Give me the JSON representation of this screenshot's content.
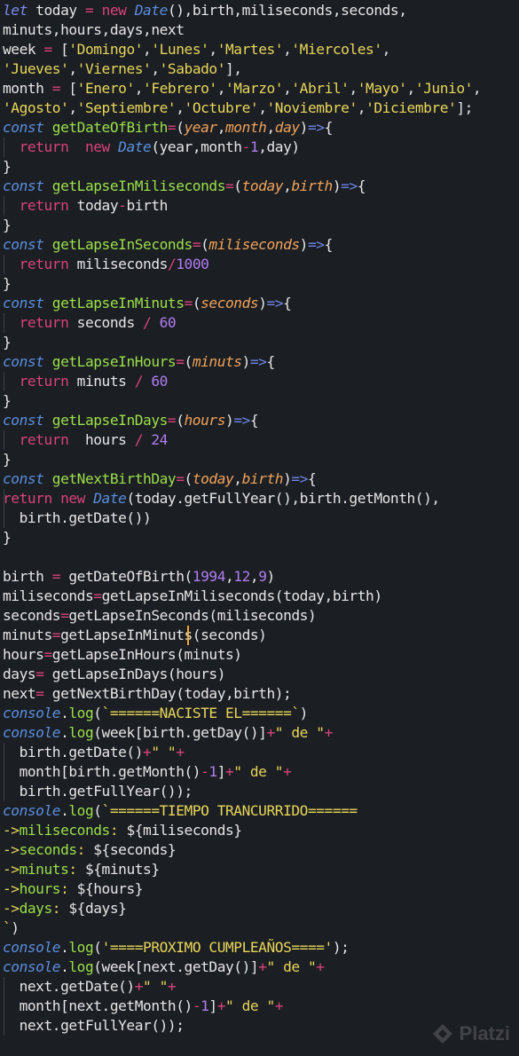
{
  "theme": {
    "background": "#1b1e23",
    "keyword": "#d8437a",
    "function_name": "#9be04a",
    "string": "#e8d65a",
    "number": "#b07ef0",
    "parameter": "#f0a35a",
    "declaration": "#5a8fe0"
  },
  "code": {
    "lines": [
      [
        [
          "let",
          "let"
        ],
        [
          "plain",
          " today "
        ],
        [
          "op",
          "="
        ],
        [
          "plain",
          " "
        ],
        [
          "kw",
          "new"
        ],
        [
          "plain",
          " "
        ],
        [
          "cls",
          "Date"
        ],
        [
          "plain",
          "(),birth,miliseconds,seconds,"
        ]
      ],
      [
        [
          "plain",
          "minuts,hours,days,next"
        ]
      ],
      [
        [
          "plain",
          "week "
        ],
        [
          "op",
          "="
        ],
        [
          "plain",
          " ["
        ],
        [
          "str",
          "'Domingo'"
        ],
        [
          "plain",
          ","
        ],
        [
          "str",
          "'Lunes'"
        ],
        [
          "plain",
          ","
        ],
        [
          "str",
          "'Martes'"
        ],
        [
          "plain",
          ","
        ],
        [
          "str",
          "'Miercoles'"
        ],
        [
          "plain",
          ","
        ]
      ],
      [
        [
          "str",
          "'Jueves'"
        ],
        [
          "plain",
          ","
        ],
        [
          "str",
          "'Viernes'"
        ],
        [
          "plain",
          ","
        ],
        [
          "str",
          "'Sabado'"
        ],
        [
          "plain",
          "],"
        ]
      ],
      [
        [
          "plain",
          "month "
        ],
        [
          "op",
          "="
        ],
        [
          "plain",
          " ["
        ],
        [
          "str",
          "'Enero'"
        ],
        [
          "plain",
          ","
        ],
        [
          "str",
          "'Febrero'"
        ],
        [
          "plain",
          ","
        ],
        [
          "str",
          "'Marzo'"
        ],
        [
          "plain",
          ","
        ],
        [
          "str",
          "'Abril'"
        ],
        [
          "plain",
          ","
        ],
        [
          "str",
          "'Mayo'"
        ],
        [
          "plain",
          ","
        ],
        [
          "str",
          "'Junio'"
        ],
        [
          "plain",
          ","
        ]
      ],
      [
        [
          "str",
          "'Agosto'"
        ],
        [
          "plain",
          ","
        ],
        [
          "str",
          "'Septiembre'"
        ],
        [
          "plain",
          ","
        ],
        [
          "str",
          "'Octubre'"
        ],
        [
          "plain",
          ","
        ],
        [
          "str",
          "'Noviembre'"
        ],
        [
          "plain",
          ","
        ],
        [
          "str",
          "'Diciembre'"
        ],
        [
          "plain",
          "];"
        ]
      ],
      [
        [
          "cons",
          "const"
        ],
        [
          "plain",
          " "
        ],
        [
          "fn",
          "getDateOfBirth"
        ],
        [
          "op",
          "="
        ],
        [
          "plain",
          "("
        ],
        [
          "par",
          "year"
        ],
        [
          "plain",
          ","
        ],
        [
          "par",
          "month"
        ],
        [
          "plain",
          ","
        ],
        [
          "par",
          "day"
        ],
        [
          "plain",
          ")"
        ],
        [
          "arrw",
          "=>"
        ],
        [
          "plain",
          "{"
        ]
      ],
      [
        [
          "plain",
          "  "
        ],
        [
          "kw",
          "return"
        ],
        [
          "plain",
          "  "
        ],
        [
          "kw",
          "new"
        ],
        [
          "plain",
          " "
        ],
        [
          "cls",
          "Date"
        ],
        [
          "plain",
          "(year,month"
        ],
        [
          "op",
          "-"
        ],
        [
          "num",
          "1"
        ],
        [
          "plain",
          ",day)"
        ]
      ],
      [
        [
          "plain",
          "}"
        ]
      ],
      [
        [
          "cons",
          "const"
        ],
        [
          "plain",
          " "
        ],
        [
          "fn",
          "getLapseInMiliseconds"
        ],
        [
          "op",
          "="
        ],
        [
          "plain",
          "("
        ],
        [
          "par",
          "today"
        ],
        [
          "plain",
          ","
        ],
        [
          "par",
          "birth"
        ],
        [
          "plain",
          ")"
        ],
        [
          "arrw",
          "=>"
        ],
        [
          "plain",
          "{"
        ]
      ],
      [
        [
          "plain",
          "  "
        ],
        [
          "kw",
          "return"
        ],
        [
          "plain",
          " today"
        ],
        [
          "op",
          "-"
        ],
        [
          "plain",
          "birth"
        ]
      ],
      [
        [
          "plain",
          "}"
        ]
      ],
      [
        [
          "cons",
          "const"
        ],
        [
          "plain",
          " "
        ],
        [
          "fn",
          "getLapseInSeconds"
        ],
        [
          "op",
          "="
        ],
        [
          "plain",
          "("
        ],
        [
          "par",
          "miliseconds"
        ],
        [
          "plain",
          ")"
        ],
        [
          "arrw",
          "=>"
        ],
        [
          "plain",
          "{"
        ]
      ],
      [
        [
          "plain",
          "  "
        ],
        [
          "kw",
          "return"
        ],
        [
          "plain",
          " miliseconds"
        ],
        [
          "op",
          "/"
        ],
        [
          "num",
          "1000"
        ]
      ],
      [
        [
          "plain",
          "}"
        ]
      ],
      [
        [
          "cons",
          "const"
        ],
        [
          "plain",
          " "
        ],
        [
          "fn",
          "getLapseInMinuts"
        ],
        [
          "op",
          "="
        ],
        [
          "plain",
          "("
        ],
        [
          "par",
          "seconds"
        ],
        [
          "plain",
          ")"
        ],
        [
          "arrw",
          "=>"
        ],
        [
          "plain",
          "{"
        ]
      ],
      [
        [
          "plain",
          "  "
        ],
        [
          "kw",
          "return"
        ],
        [
          "plain",
          " seconds "
        ],
        [
          "op",
          "/"
        ],
        [
          "plain",
          " "
        ],
        [
          "num",
          "60"
        ]
      ],
      [
        [
          "plain",
          "}"
        ]
      ],
      [
        [
          "cons",
          "const"
        ],
        [
          "plain",
          " "
        ],
        [
          "fn",
          "getLapseInHours"
        ],
        [
          "op",
          "="
        ],
        [
          "plain",
          "("
        ],
        [
          "par",
          "minuts"
        ],
        [
          "plain",
          ")"
        ],
        [
          "arrw",
          "=>"
        ],
        [
          "plain",
          "{"
        ]
      ],
      [
        [
          "plain",
          "  "
        ],
        [
          "kw",
          "return"
        ],
        [
          "plain",
          " minuts "
        ],
        [
          "op",
          "/"
        ],
        [
          "plain",
          " "
        ],
        [
          "num",
          "60"
        ]
      ],
      [
        [
          "plain",
          "}"
        ]
      ],
      [
        [
          "cons",
          "const"
        ],
        [
          "plain",
          " "
        ],
        [
          "fn",
          "getLapseInDays"
        ],
        [
          "op",
          "="
        ],
        [
          "plain",
          "("
        ],
        [
          "par",
          "hours"
        ],
        [
          "plain",
          ")"
        ],
        [
          "arrw",
          "=>"
        ],
        [
          "plain",
          "{"
        ]
      ],
      [
        [
          "plain",
          "  "
        ],
        [
          "kw",
          "return"
        ],
        [
          "plain",
          "  hours "
        ],
        [
          "op",
          "/"
        ],
        [
          "plain",
          " "
        ],
        [
          "num",
          "24"
        ]
      ],
      [
        [
          "plain",
          "}"
        ]
      ],
      [
        [
          "cons",
          "const"
        ],
        [
          "plain",
          " "
        ],
        [
          "fn",
          "getNextBirthDay"
        ],
        [
          "op",
          "="
        ],
        [
          "plain",
          "("
        ],
        [
          "par",
          "today"
        ],
        [
          "plain",
          ","
        ],
        [
          "par",
          "birth"
        ],
        [
          "plain",
          ")"
        ],
        [
          "arrw",
          "=>"
        ],
        [
          "plain",
          "{"
        ]
      ],
      [
        [
          "kw",
          "return"
        ],
        [
          "plain",
          " "
        ],
        [
          "kw",
          "new"
        ],
        [
          "plain",
          " "
        ],
        [
          "cls",
          "Date"
        ],
        [
          "plain",
          "(today.getFullYear(),birth.getMonth(),"
        ]
      ],
      [
        [
          "plain",
          "  birth.getDate())"
        ]
      ],
      [
        [
          "plain",
          "}"
        ]
      ],
      [
        [
          "plain",
          ""
        ]
      ],
      [
        [
          "plain",
          "birth "
        ],
        [
          "op",
          "="
        ],
        [
          "plain",
          " getDateOfBirth("
        ],
        [
          "num",
          "1994"
        ],
        [
          "plain",
          ","
        ],
        [
          "num",
          "12"
        ],
        [
          "plain",
          ","
        ],
        [
          "num",
          "9"
        ],
        [
          "plain",
          ")"
        ]
      ],
      [
        [
          "plain",
          "miliseconds"
        ],
        [
          "op",
          "="
        ],
        [
          "plain",
          "getLapseInMiliseconds(today,birth)"
        ]
      ],
      [
        [
          "plain",
          "seconds"
        ],
        [
          "op",
          "="
        ],
        [
          "plain",
          "getLapseInSeconds(miliseconds)"
        ]
      ],
      [
        [
          "plain",
          "minuts"
        ],
        [
          "op",
          "="
        ],
        [
          "plain",
          "getLapseInMinuts(seconds)"
        ]
      ],
      [
        [
          "plain",
          "hours"
        ],
        [
          "op",
          "="
        ],
        [
          "plain",
          "getLapseInHours(minuts)"
        ]
      ],
      [
        [
          "plain",
          "days"
        ],
        [
          "op",
          "="
        ],
        [
          "plain",
          " getLapseInDays(hours)"
        ]
      ],
      [
        [
          "plain",
          "next"
        ],
        [
          "op",
          "="
        ],
        [
          "plain",
          " getNextBirthDay(today,birth);"
        ]
      ],
      [
        [
          "cons",
          "console"
        ],
        [
          "plain",
          "."
        ],
        [
          "fn",
          "log"
        ],
        [
          "plain",
          "("
        ],
        [
          "str",
          "`======NACISTE EL======`"
        ],
        [
          "plain",
          ")"
        ]
      ],
      [
        [
          "cons",
          "console"
        ],
        [
          "plain",
          "."
        ],
        [
          "fn",
          "log"
        ],
        [
          "plain",
          "(week[birth.getDay()]"
        ],
        [
          "op",
          "+"
        ],
        [
          "str",
          "\" de \""
        ],
        [
          "op",
          "+"
        ]
      ],
      [
        [
          "plain",
          "  birth.getDate()"
        ],
        [
          "op",
          "+"
        ],
        [
          "str",
          "\" \""
        ],
        [
          "op",
          "+"
        ]
      ],
      [
        [
          "plain",
          "  month[birth.getMonth()"
        ],
        [
          "op",
          "-"
        ],
        [
          "num",
          "1"
        ],
        [
          "plain",
          "]"
        ],
        [
          "op",
          "+"
        ],
        [
          "str",
          "\" de \""
        ],
        [
          "op",
          "+"
        ]
      ],
      [
        [
          "plain",
          "  birth.getFullYear());"
        ]
      ],
      [
        [
          "cons",
          "console"
        ],
        [
          "plain",
          "."
        ],
        [
          "fn",
          "log"
        ],
        [
          "plain",
          "("
        ],
        [
          "str",
          "`======TIEMPO TRANCURRIDO======"
        ]
      ],
      [
        [
          "str",
          "->"
        ],
        [
          "fn",
          "miliseconds"
        ],
        [
          "str",
          ": "
        ],
        [
          "plain",
          "${miliseconds}"
        ]
      ],
      [
        [
          "str",
          "->"
        ],
        [
          "fn",
          "seconds"
        ],
        [
          "str",
          ": "
        ],
        [
          "plain",
          "${seconds}"
        ]
      ],
      [
        [
          "str",
          "->"
        ],
        [
          "fn",
          "minuts"
        ],
        [
          "str",
          ": "
        ],
        [
          "plain",
          "${minuts}"
        ]
      ],
      [
        [
          "str",
          "->"
        ],
        [
          "fn",
          "hours"
        ],
        [
          "str",
          ": "
        ],
        [
          "plain",
          "${hours}"
        ]
      ],
      [
        [
          "str",
          "->"
        ],
        [
          "fn",
          "days"
        ],
        [
          "str",
          ": "
        ],
        [
          "plain",
          "${days}"
        ]
      ],
      [
        [
          "str",
          "`"
        ],
        [
          "plain",
          ")"
        ]
      ],
      [
        [
          "cons",
          "console"
        ],
        [
          "plain",
          "."
        ],
        [
          "fn",
          "log"
        ],
        [
          "plain",
          "("
        ],
        [
          "str",
          "'====PROXIMO CUMPLEAÑOS===='"
        ],
        [
          "plain",
          ");"
        ]
      ],
      [
        [
          "cons",
          "console"
        ],
        [
          "plain",
          "."
        ],
        [
          "fn",
          "log"
        ],
        [
          "plain",
          "(week[next.getDay()]"
        ],
        [
          "op",
          "+"
        ],
        [
          "str",
          "\" de \""
        ],
        [
          "op",
          "+"
        ]
      ],
      [
        [
          "plain",
          "  next.getDate()"
        ],
        [
          "op",
          "+"
        ],
        [
          "str",
          "\" \""
        ],
        [
          "op",
          "+"
        ]
      ],
      [
        [
          "plain",
          "  month[next.getMonth()"
        ],
        [
          "op",
          "-"
        ],
        [
          "num",
          "1"
        ],
        [
          "plain",
          "]"
        ],
        [
          "op",
          "+"
        ],
        [
          "str",
          "\" de \""
        ],
        [
          "op",
          "+"
        ]
      ],
      [
        [
          "plain",
          "  next.getFullYear());"
        ]
      ]
    ]
  },
  "watermark": {
    "label": "Platzi",
    "icon": "platzi-logo-icon"
  }
}
